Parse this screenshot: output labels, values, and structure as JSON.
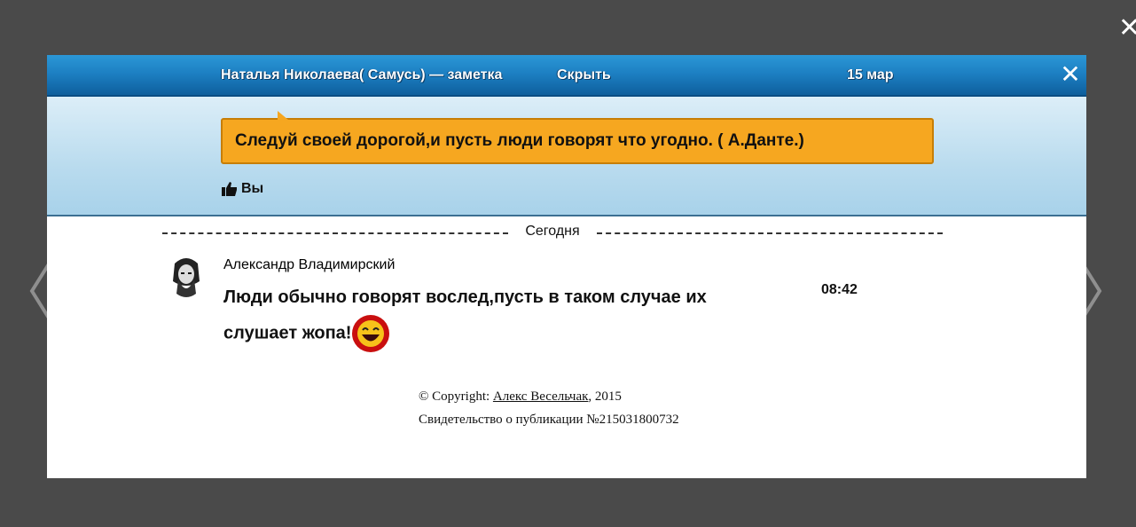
{
  "header": {
    "author_title": "Наталья Николаева( Самусь) — заметка",
    "hide_label": "Скрыть",
    "date": "15 мар"
  },
  "note": {
    "text": "Следуй своей дорогой,и пусть люди говорят что угодно. ( А.Данте.)",
    "likes_label": "Вы"
  },
  "day_separator": "Сегодня",
  "comment": {
    "author": "Александр Владимирский",
    "text": "Люди обычно говорят вослед,пусть в таком случае их слушает жопа!",
    "time": "08:42"
  },
  "footer": {
    "copyright_prefix": "© Copyright: ",
    "copyright_author": "Алекс Весельчак",
    "copyright_year": ", 2015",
    "certificate": "Свидетельство о публикации №215031800732"
  },
  "colors": {
    "overlay": "#4a4a4a",
    "header_blue": "#1d80c3",
    "bubble_orange": "#f6a720"
  },
  "icons": {
    "close": "close-icon",
    "prev": "chevron-left-icon",
    "next": "chevron-right-icon",
    "like": "thumbs-up-icon",
    "emoji": "laughing-emoji-icon"
  }
}
